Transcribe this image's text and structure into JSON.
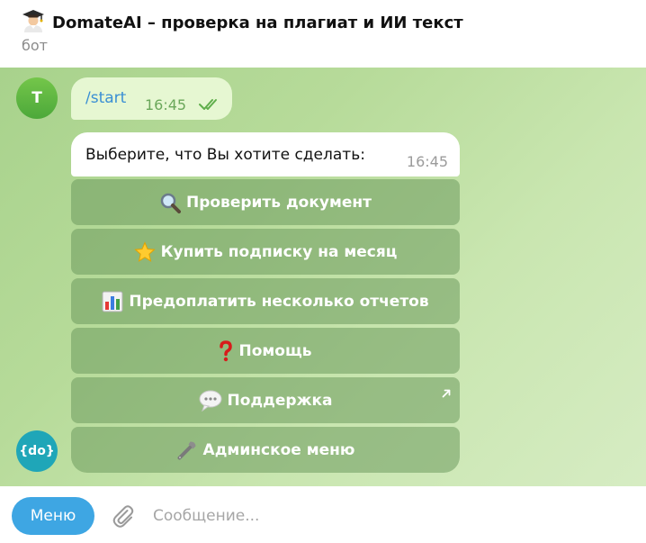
{
  "header": {
    "title": "DomateAI – проверка на плагиат и ИИ текст",
    "subtitle": "бот",
    "avatar_icon": "graduate-emoji-icon"
  },
  "messages": {
    "user": {
      "avatar_letter": "T",
      "text": "/start",
      "time": "16:45",
      "status_icon": "double-check-icon"
    },
    "bot": {
      "avatar_text": "{do}",
      "text": "Выберите, что Вы хотите сделать:",
      "time": "16:45"
    }
  },
  "keyboard": {
    "buttons": [
      {
        "icon": "magnifier-icon",
        "label": "Проверить документ"
      },
      {
        "icon": "star-icon",
        "label": "Купить подписку на месяц"
      },
      {
        "icon": "bar-chart-icon",
        "label": "Предоплатить несколько отчетов"
      },
      {
        "icon": "question-mark-icon",
        "label": "Помощь"
      },
      {
        "icon": "speech-bubble-icon",
        "label": "Поддержка",
        "external": true
      },
      {
        "icon": "wrench-icon",
        "label": "Админское меню"
      }
    ]
  },
  "composer": {
    "menu_label": "Меню",
    "input_placeholder": "Сообщение..."
  },
  "colors": {
    "menu_button": "#3ea6e3",
    "user_bubble": "#e6f7d2",
    "link_text": "#3a8fd4",
    "bot_avatar": "#1fa6b8"
  }
}
